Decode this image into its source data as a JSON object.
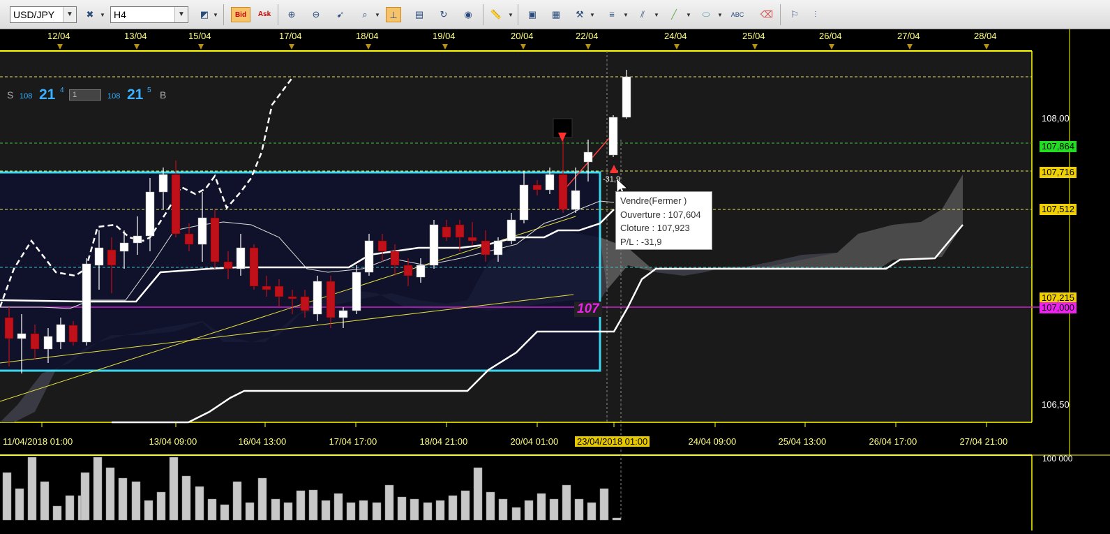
{
  "toolbar": {
    "symbol": "USD/JPY",
    "timeframe": "H4",
    "bid_label": "Bid",
    "ask_label": "Ask",
    "icons": [
      "chart-type-icon",
      "bid-icon",
      "ask-icon",
      "zoom-in-icon",
      "zoom-out-icon",
      "cursor-icon",
      "magnify-icon",
      "crosshair-icon",
      "template-icon",
      "refresh-icon",
      "globe-icon",
      "ruler-icon",
      "image-icon",
      "chart-window-icon",
      "tools-icon",
      "lines-icon",
      "fib-icon",
      "trendline-icon",
      "ellipse-icon",
      "text-icon",
      "eraser-icon",
      "hierarchy-icon",
      "more-icon"
    ]
  },
  "spread_panel": {
    "sell_label": "S",
    "sell_big": "108",
    "sell_price": "21",
    "sell_sup": "4",
    "lot": "1",
    "buy_big": "108",
    "buy_price": "21",
    "buy_sup": "5",
    "buy_label": "B"
  },
  "top_dates": [
    "12/04",
    "13/04",
    "15/04",
    "17/04",
    "18/04",
    "19/04",
    "20/04",
    "22/04",
    "24/04",
    "25/04",
    "26/04",
    "27/04",
    "28/04"
  ],
  "bottom_dates": [
    "11/04/2018 01:00",
    "13/04 09:00",
    "16/04 13:00",
    "17/04 17:00",
    "18/04 21:00",
    "20/04 01:00",
    "23/04/2018 01:00",
    "24/04 09:00",
    "25/04 13:00",
    "26/04 17:00",
    "27/04 21:00"
  ],
  "price_labels": [
    {
      "text": "108,00",
      "style": "plain"
    },
    {
      "text": "107,864",
      "style": "green"
    },
    {
      "text": "107,716",
      "style": "yellow"
    },
    {
      "text": "107,512",
      "style": "yellow"
    },
    {
      "text": "107,215",
      "style": "yellow"
    },
    {
      "text": "107,000",
      "style": "magenta"
    },
    {
      "text": "106,50",
      "style": "plain"
    }
  ],
  "level_tag": "107",
  "trade_marker": "-31,9",
  "tooltip": {
    "line1": "Vendre(Fermer )",
    "line2": "Ouverture : 107,604",
    "line3": "Cloture : 107,923",
    "line4": "P/L : -31,9"
  },
  "volume_label": "100 000",
  "colors": {
    "bull": "#ffffff",
    "bear": "#c0101a",
    "cloud_dark": "#3c3c48",
    "cloud_light": "#555555",
    "range_box": "#3ad8ee",
    "magenta": "#cc22cc",
    "grid_tick": "#e8e860",
    "axis_yellow": "#ffff00"
  }
}
